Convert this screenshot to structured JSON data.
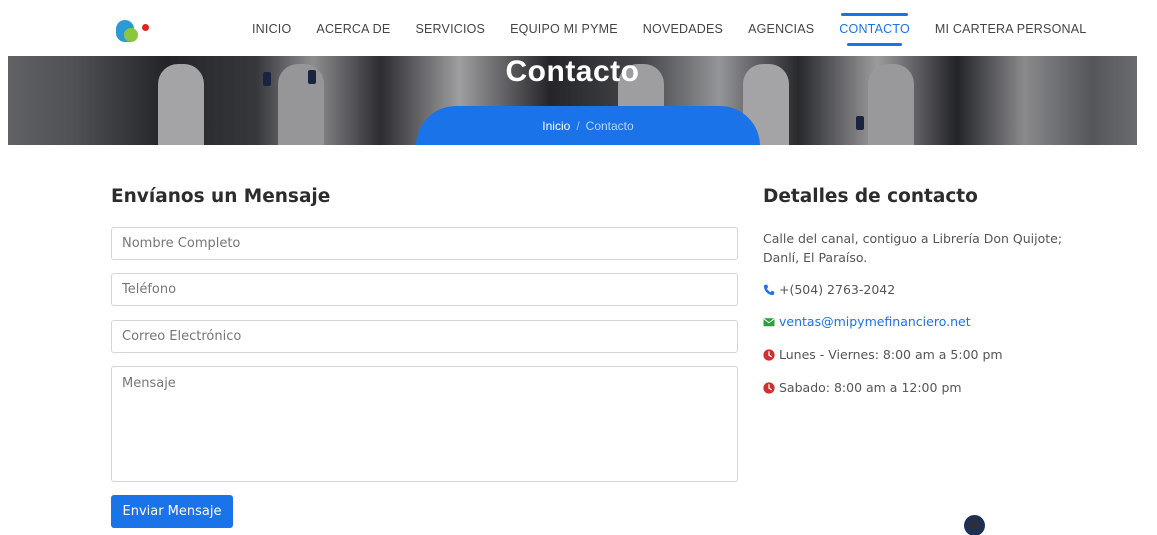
{
  "nav": {
    "items": [
      {
        "label": "INICIO",
        "active": false
      },
      {
        "label": "ACERCA DE",
        "active": false
      },
      {
        "label": "SERVICIOS",
        "active": false
      },
      {
        "label": "EQUIPO MI PYME",
        "active": false
      },
      {
        "label": "NOVEDADES",
        "active": false
      },
      {
        "label": "AGENCIAS",
        "active": false
      },
      {
        "label": "CONTACTO",
        "active": true
      },
      {
        "label": "MI CARTERA PERSONAL",
        "active": false
      }
    ]
  },
  "hero": {
    "title": "Contacto",
    "breadcrumb": {
      "home": "Inicio",
      "separator": "/",
      "current": "Contacto"
    }
  },
  "form": {
    "title": "Envíanos un Mensaje",
    "name_placeholder": "Nombre Completo",
    "phone_placeholder": "Teléfono",
    "email_placeholder": "Correo Electrónico",
    "message_placeholder": "Mensaje",
    "submit_label": "Enviar Mensaje"
  },
  "details": {
    "title": "Detalles de contacto",
    "address": "Calle del canal, contiguo a Librería Don Quijote; Danlí, El Paraíso.",
    "phone": "+(504) 2763-2042",
    "email": "ventas@mipymefinanciero.net",
    "hours_weekdays": "Lunes - Viernes: 8:00 am a 5:00 pm",
    "hours_saturday": "Sabado: 8:00 am a 12:00 pm"
  },
  "colors": {
    "accent": "#1a73e8",
    "phone_icon": "#1a73e8",
    "email_icon": "#2e9e3a",
    "clock_icon": "#d32f2f"
  },
  "icons": {
    "phone": "phone-icon",
    "email": "envelope-icon",
    "clock": "clock-icon"
  }
}
